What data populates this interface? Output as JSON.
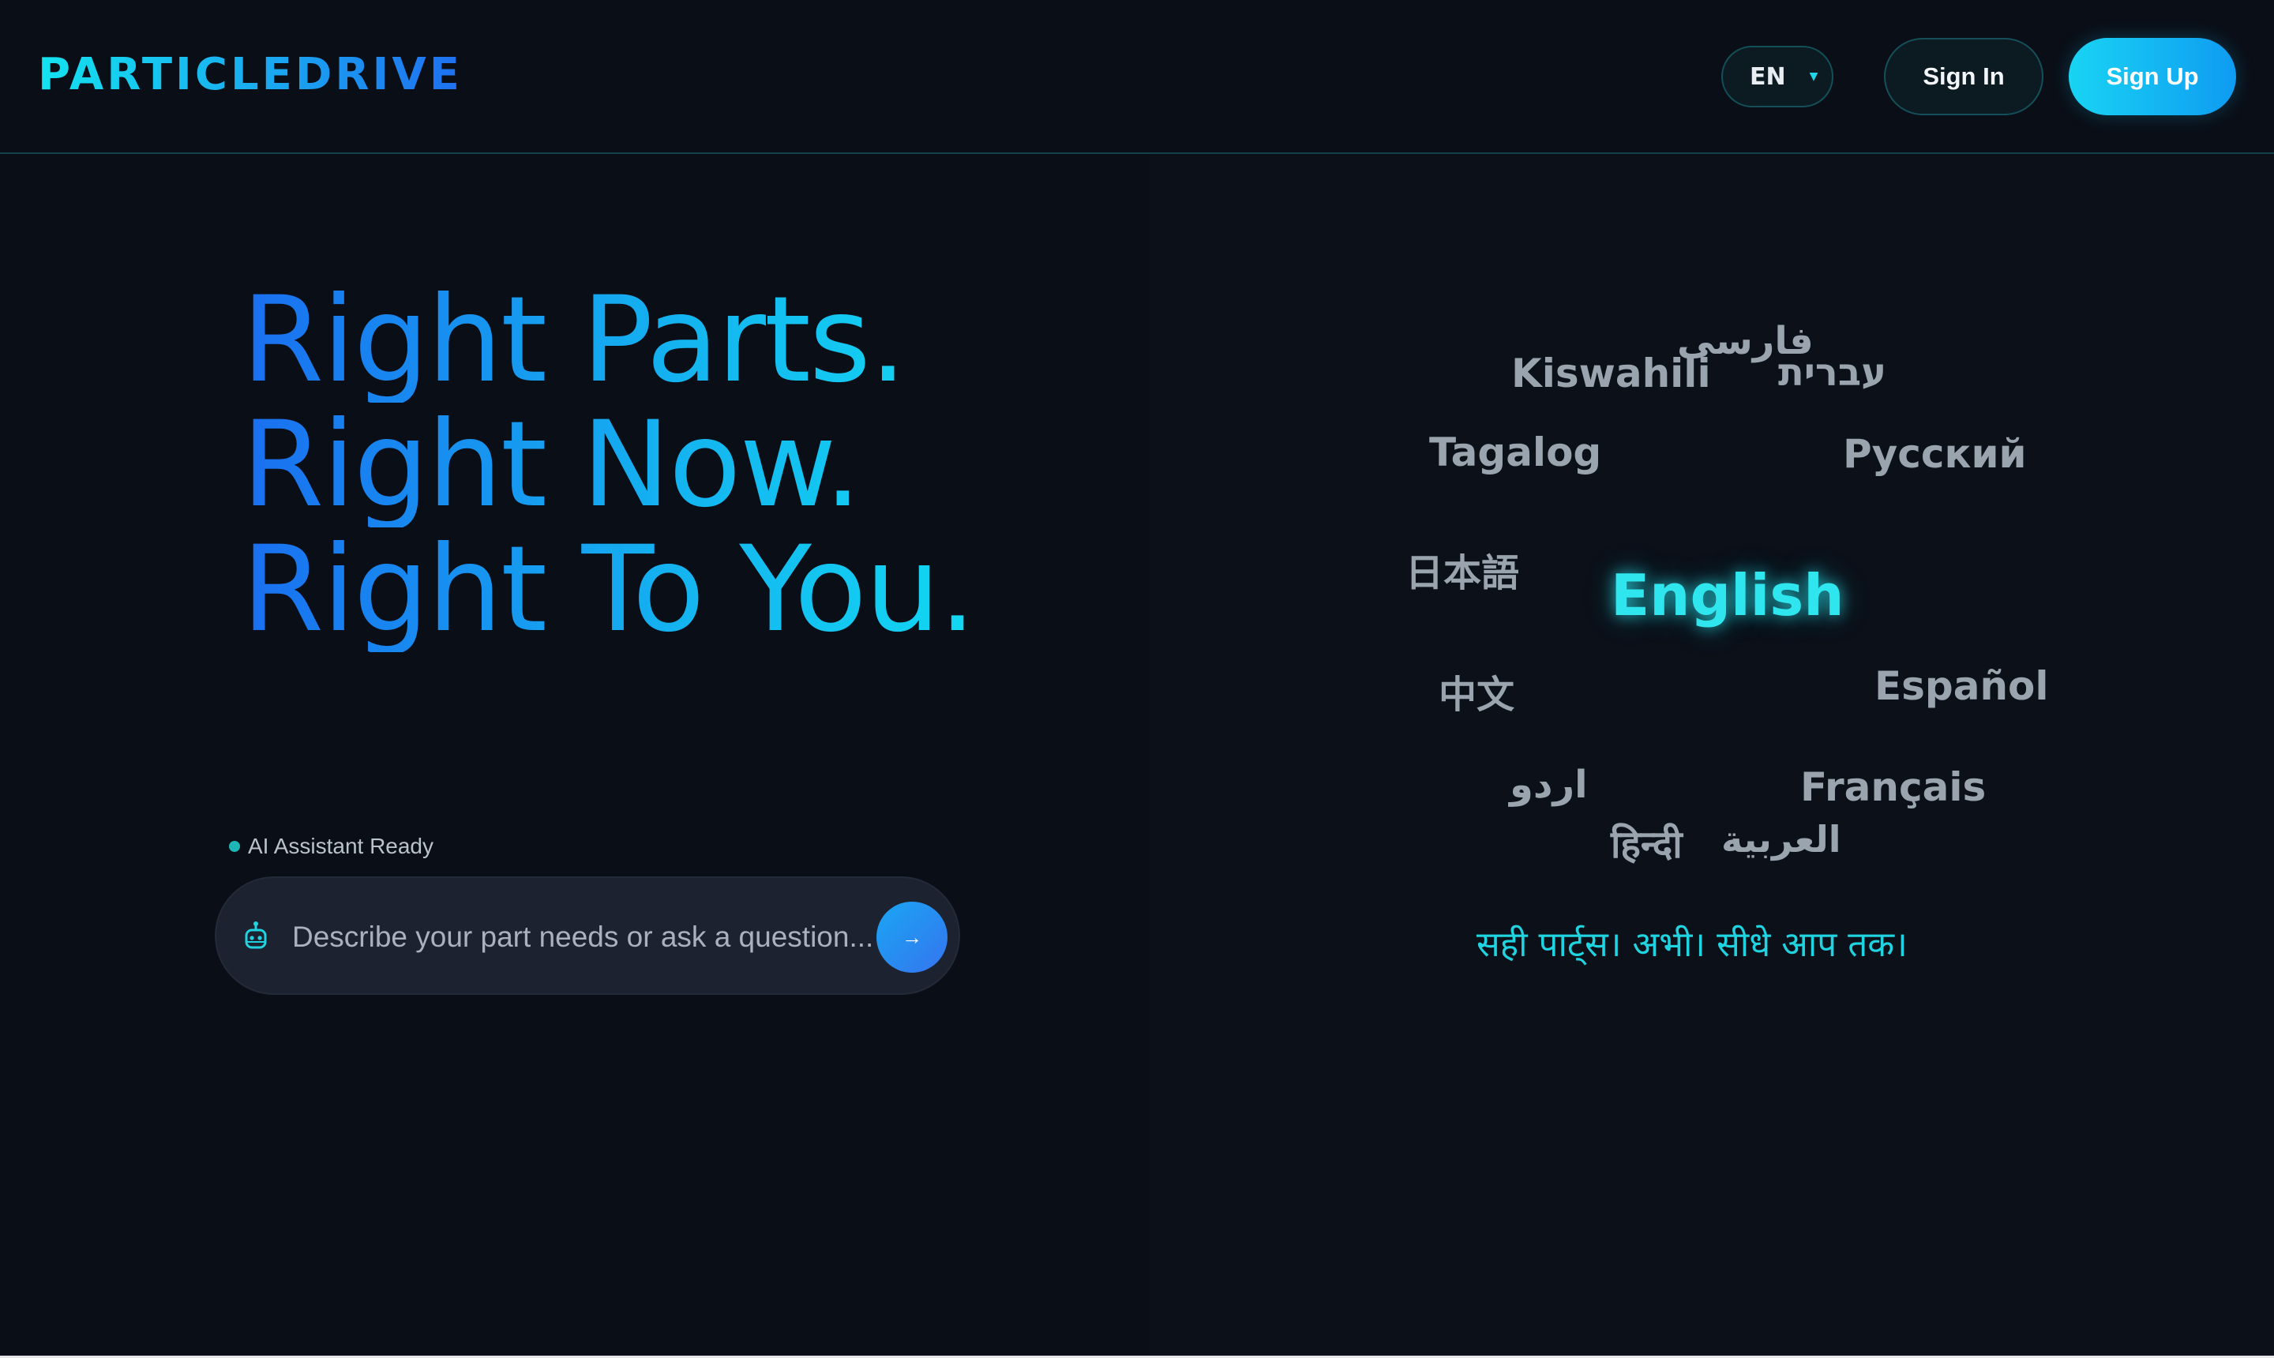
{
  "brand": {
    "logo": "PARTICLEDRIVE"
  },
  "header": {
    "language": {
      "selected": "EN"
    },
    "sign_in_label": "Sign In",
    "sign_up_label": "Sign Up"
  },
  "hero": {
    "lines": [
      "Right Parts.",
      "Right Now.",
      "Right To You."
    ]
  },
  "assistant": {
    "status": "AI Assistant Ready",
    "placeholder": "Describe your part needs or ask a question...",
    "send_icon": "→"
  },
  "languages": {
    "active": "English",
    "words": {
      "kiswahili": "Kiswahili",
      "farsi": "فارسی",
      "hebrew": "עברית",
      "tagalog": "Tagalog",
      "russian": "Русский",
      "japanese": "日本語",
      "chinese": "中文",
      "spanish": "Español",
      "urdu": "اردو",
      "french": "Français",
      "hindi": "हिन्दी",
      "arabic": "العربية"
    },
    "tagline": "सही पार्ट्स। अभी। सीधे आप तक।"
  },
  "colors": {
    "background": "#0a0e17",
    "accent_cyan": "#2fe6ee",
    "accent_blue": "#1a6ff0",
    "muted_text": "#9aa4ae"
  },
  "icons": {
    "assistant_icon": "robot-icon",
    "send_icon": "arrow-right-icon",
    "language_caret": "caret-down-icon"
  }
}
